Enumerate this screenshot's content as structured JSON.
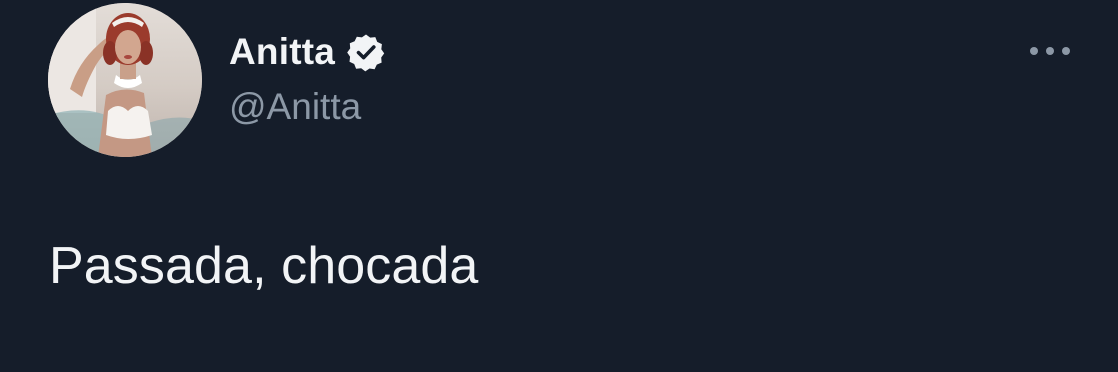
{
  "tweet": {
    "author": {
      "display_name": "Anitta",
      "handle": "@Anitta",
      "verified": true,
      "avatar": "profile-photo-avatar",
      "verified_icon": "verified-badge-icon"
    },
    "more_icon": "more-options-icon",
    "text": "Passada, chocada"
  },
  "colors": {
    "background": "#151d2a",
    "text_primary": "#f2f4f6",
    "text_secondary": "#8c98a6"
  }
}
